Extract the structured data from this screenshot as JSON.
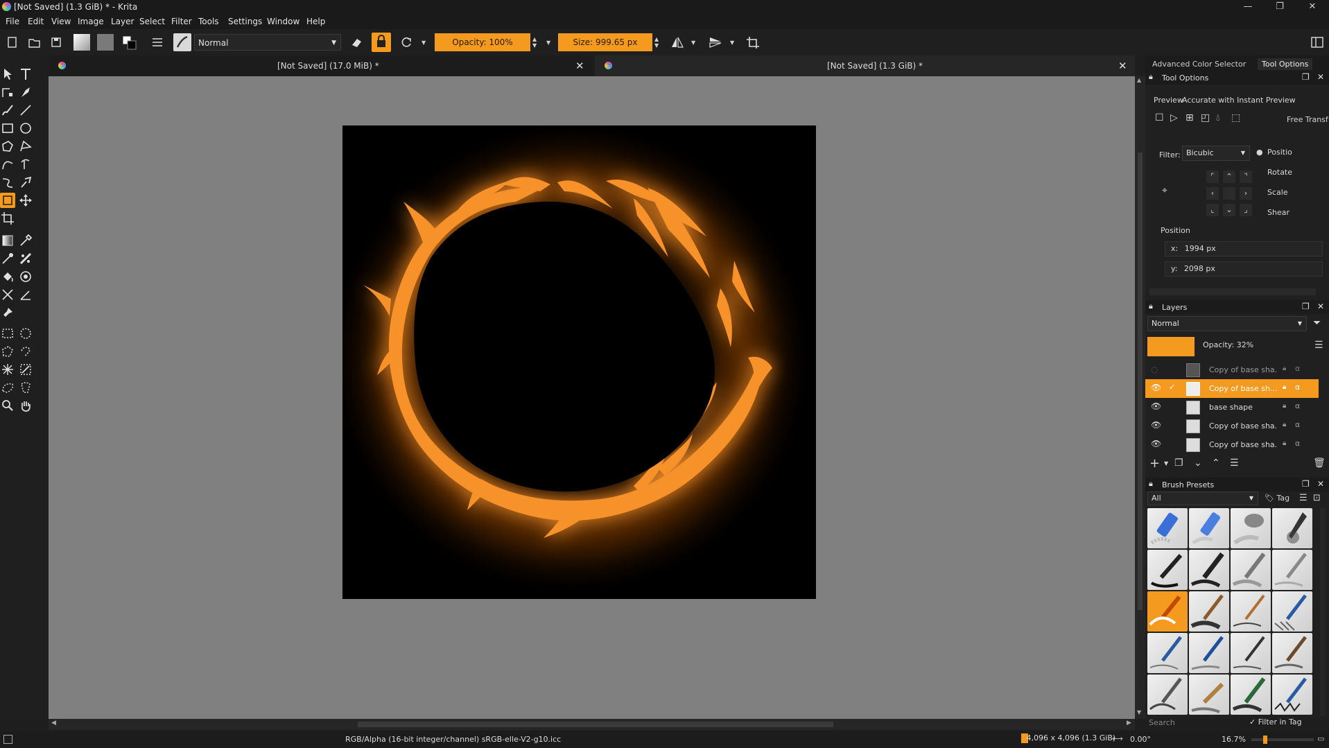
{
  "window": {
    "title": "[Not Saved]  (1.3 GiB) * - Krita",
    "minimize": "—",
    "maximize": "❐",
    "close": "✕"
  },
  "menu": [
    "File",
    "Edit",
    "View",
    "Image",
    "Layer",
    "Select",
    "Filter",
    "Tools",
    "Settings",
    "Window",
    "Help"
  ],
  "toolbar": {
    "blend_mode": "Normal",
    "opacity": "Opacity: 100%",
    "size": "Size: 999.65 px"
  },
  "tabs": [
    {
      "label": "[Not Saved]  (17.0 MiB) *"
    },
    {
      "label": "[Not Saved]  (1.3 GiB) *"
    }
  ],
  "docker_tabs": [
    "Advanced Color Selector",
    "Tool Options"
  ],
  "tool_options": {
    "title": "Tool Options",
    "preview_label": "Preview",
    "preview_value": "Accurate with Instant Preview",
    "mode_label": "Free Transf",
    "filter_label": "Filter:",
    "filter_value": "Bicubic",
    "radio_options": [
      "Positio",
      "Rotate",
      "Scale",
      "Shear"
    ],
    "position_label": "Position",
    "x_label": "x:",
    "x_value": "1994 px",
    "y_label": "y:",
    "y_value": "2098 px"
  },
  "layers": {
    "title": "Layers",
    "blend_mode": "Normal",
    "opacity": "Opacity:  32%",
    "accent_color": "#f39a1f",
    "items": [
      {
        "name": "Copy of base sha...",
        "visible": false,
        "selected": false
      },
      {
        "name": "Copy of base sh...",
        "visible": true,
        "selected": true
      },
      {
        "name": "base shape",
        "visible": true,
        "selected": false
      },
      {
        "name": "Copy of base sha...",
        "visible": true,
        "selected": false
      },
      {
        "name": "Copy of base sha...",
        "visible": true,
        "selected": false
      }
    ]
  },
  "brush_presets": {
    "title": "Brush Presets",
    "filter_value": "All",
    "tag_label": "Tag",
    "search_placeholder": "Search",
    "filter_in_tag": "Filter in Tag"
  },
  "status": {
    "color_info": "RGB/Alpha (16-bit integer/channel)  sRGB-elle-V2-g10.icc",
    "image_size": "4,096 x 4,096 (1.3 GiB)",
    "rotation": "0.00°",
    "zoom": "16.7%"
  }
}
